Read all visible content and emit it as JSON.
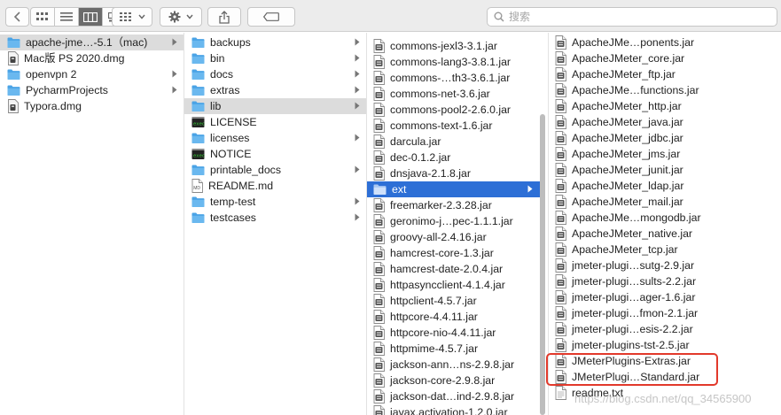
{
  "toolbar": {
    "search_placeholder": "搜索",
    "view_buttons": [
      "list-view-icon",
      "columns-view-icon",
      "gallery-view-icon",
      "icon-view-icon"
    ],
    "arrange_icon": "grid-group-icon",
    "action_icon": "gear-icon",
    "share_icon": "share-icon",
    "tag_icon": "tag-icon"
  },
  "columns": [
    {
      "items": [
        {
          "name": "apache-jme…-5.1（mac)",
          "type": "folder",
          "chevron": true,
          "state": "highlighted"
        },
        {
          "name": "Mac版 PS 2020.dmg",
          "type": "dmg",
          "chevron": false
        },
        {
          "name": "openvpn 2",
          "type": "folder",
          "chevron": true
        },
        {
          "name": "PycharmProjects",
          "type": "folder",
          "chevron": true
        },
        {
          "name": "Typora.dmg",
          "type": "dmg",
          "chevron": false
        }
      ]
    },
    {
      "items": [
        {
          "name": "backups",
          "type": "folder",
          "chevron": true
        },
        {
          "name": "bin",
          "type": "folder",
          "chevron": true
        },
        {
          "name": "docs",
          "type": "folder",
          "chevron": true
        },
        {
          "name": "extras",
          "type": "folder",
          "chevron": true
        },
        {
          "name": "lib",
          "type": "folder",
          "chevron": true,
          "state": "highlighted"
        },
        {
          "name": "LICENSE",
          "type": "exec",
          "chevron": false
        },
        {
          "name": "licenses",
          "type": "folder",
          "chevron": true
        },
        {
          "name": "NOTICE",
          "type": "exec",
          "chevron": false
        },
        {
          "name": "printable_docs",
          "type": "folder",
          "chevron": true
        },
        {
          "name": "README.md",
          "type": "md",
          "chevron": false
        },
        {
          "name": "temp-test",
          "type": "folder",
          "chevron": true
        },
        {
          "name": "testcases",
          "type": "folder",
          "chevron": true
        }
      ]
    },
    {
      "items": [
        {
          "name": "commons-jexl3-3.1.jar",
          "type": "jar"
        },
        {
          "name": "commons-lang3-3.8.1.jar",
          "type": "jar"
        },
        {
          "name": "commons-…th3-3.6.1.jar",
          "type": "jar"
        },
        {
          "name": "commons-net-3.6.jar",
          "type": "jar"
        },
        {
          "name": "commons-pool2-2.6.0.jar",
          "type": "jar"
        },
        {
          "name": "commons-text-1.6.jar",
          "type": "jar"
        },
        {
          "name": "darcula.jar",
          "type": "jar"
        },
        {
          "name": "dec-0.1.2.jar",
          "type": "jar"
        },
        {
          "name": "dnsjava-2.1.8.jar",
          "type": "jar"
        },
        {
          "name": "ext",
          "type": "folder",
          "chevron": true,
          "state": "selected"
        },
        {
          "name": "freemarker-2.3.28.jar",
          "type": "jar"
        },
        {
          "name": "geronimo-j…pec-1.1.1.jar",
          "type": "jar"
        },
        {
          "name": "groovy-all-2.4.16.jar",
          "type": "jar"
        },
        {
          "name": "hamcrest-core-1.3.jar",
          "type": "jar"
        },
        {
          "name": "hamcrest-date-2.0.4.jar",
          "type": "jar"
        },
        {
          "name": "httpasyncclient-4.1.4.jar",
          "type": "jar"
        },
        {
          "name": "httpclient-4.5.7.jar",
          "type": "jar"
        },
        {
          "name": "httpcore-4.4.11.jar",
          "type": "jar"
        },
        {
          "name": "httpcore-nio-4.4.11.jar",
          "type": "jar"
        },
        {
          "name": "httpmime-4.5.7.jar",
          "type": "jar"
        },
        {
          "name": "jackson-ann…ns-2.9.8.jar",
          "type": "jar"
        },
        {
          "name": "jackson-core-2.9.8.jar",
          "type": "jar"
        },
        {
          "name": "jackson-dat…ind-2.9.8.jar",
          "type": "jar"
        },
        {
          "name": "javax.activation-1.2.0.jar",
          "type": "jar"
        }
      ]
    },
    {
      "items": [
        {
          "name": "ApacheJMe…ponents.jar",
          "type": "jar"
        },
        {
          "name": "ApacheJMeter_core.jar",
          "type": "jar"
        },
        {
          "name": "ApacheJMeter_ftp.jar",
          "type": "jar"
        },
        {
          "name": "ApacheJMe…functions.jar",
          "type": "jar"
        },
        {
          "name": "ApacheJMeter_http.jar",
          "type": "jar"
        },
        {
          "name": "ApacheJMeter_java.jar",
          "type": "jar"
        },
        {
          "name": "ApacheJMeter_jdbc.jar",
          "type": "jar"
        },
        {
          "name": "ApacheJMeter_jms.jar",
          "type": "jar"
        },
        {
          "name": "ApacheJMeter_junit.jar",
          "type": "jar"
        },
        {
          "name": "ApacheJMeter_ldap.jar",
          "type": "jar"
        },
        {
          "name": "ApacheJMeter_mail.jar",
          "type": "jar"
        },
        {
          "name": "ApacheJMe…mongodb.jar",
          "type": "jar"
        },
        {
          "name": "ApacheJMeter_native.jar",
          "type": "jar"
        },
        {
          "name": "ApacheJMeter_tcp.jar",
          "type": "jar"
        },
        {
          "name": "jmeter-plugi…sutg-2.9.jar",
          "type": "jar"
        },
        {
          "name": "jmeter-plugi…sults-2.2.jar",
          "type": "jar"
        },
        {
          "name": "jmeter-plugi…ager-1.6.jar",
          "type": "jar"
        },
        {
          "name": "jmeter-plugi…fmon-2.1.jar",
          "type": "jar"
        },
        {
          "name": "jmeter-plugi…esis-2.2.jar",
          "type": "jar"
        },
        {
          "name": "jmeter-plugins-tst-2.5.jar",
          "type": "jar"
        },
        {
          "name": "JMeterPlugins-Extras.jar",
          "type": "jar",
          "boxed": true
        },
        {
          "name": "JMeterPlugi…Standard.jar",
          "type": "jar",
          "boxed": true
        },
        {
          "name": "readme.txt",
          "type": "txt"
        }
      ]
    }
  ],
  "watermark": "https://blog.csdn.net/qq_34565900",
  "colors": {
    "selection": "#2d6fd6",
    "highlight": "#dcdcdc",
    "folder": "#6ab8ef",
    "annotation_box": "#e2392b"
  }
}
